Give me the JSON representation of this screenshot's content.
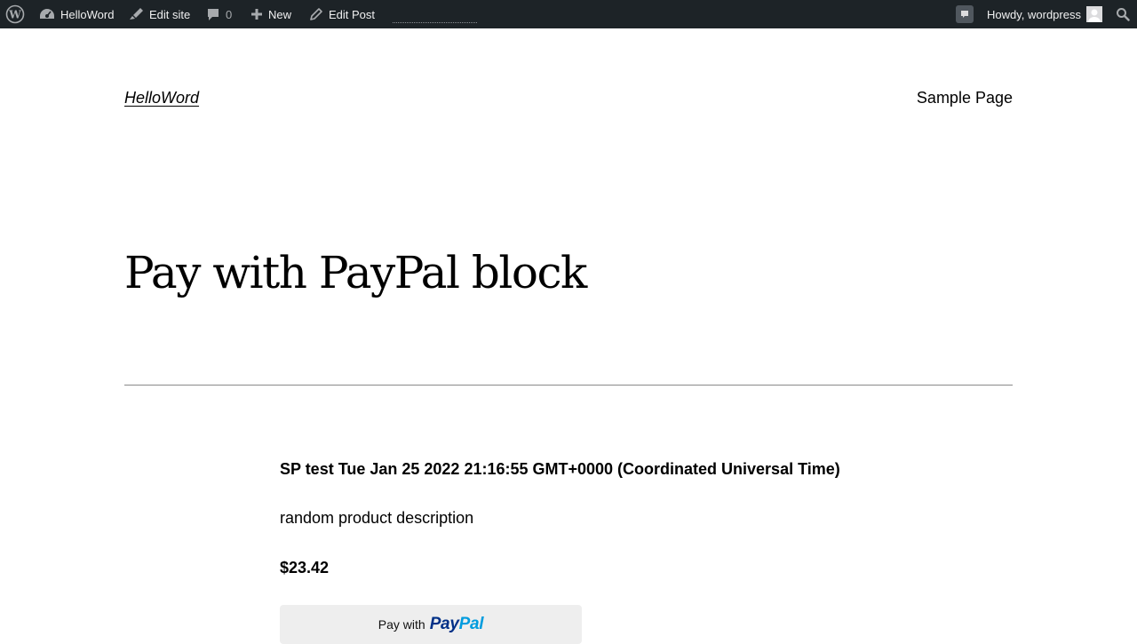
{
  "admin_bar": {
    "site_name": "HelloWord",
    "edit_site": "Edit site",
    "comments_count": "0",
    "new": "New",
    "edit_post": "Edit Post",
    "howdy": "Howdy, wordpress",
    "icons": [
      "wordpress-logo-icon",
      "dashboard-icon",
      "brush-icon",
      "comment-bubble-icon",
      "plus-icon",
      "pencil-icon",
      "notification-icon",
      "avatar-icon",
      "search-icon"
    ],
    "background_color": "#1d2327",
    "text_color": "#f0f0f1"
  },
  "header": {
    "site_title": "HelloWord",
    "nav": {
      "sample_page": "Sample Page"
    }
  },
  "post": {
    "title": "Pay with PayPal block"
  },
  "product": {
    "name": "SP test Tue Jan 25 2022 21:16:55 GMT+0000 (Coordinated Universal Time)",
    "description": "random product description",
    "price": "$23.42",
    "button": {
      "prefix": "Pay with",
      "logo_part1": "Pay",
      "logo_part2": "Pal",
      "logo_dark_color": "#003087",
      "logo_light_color": "#009cde",
      "background_color": "#eeeeee"
    }
  }
}
